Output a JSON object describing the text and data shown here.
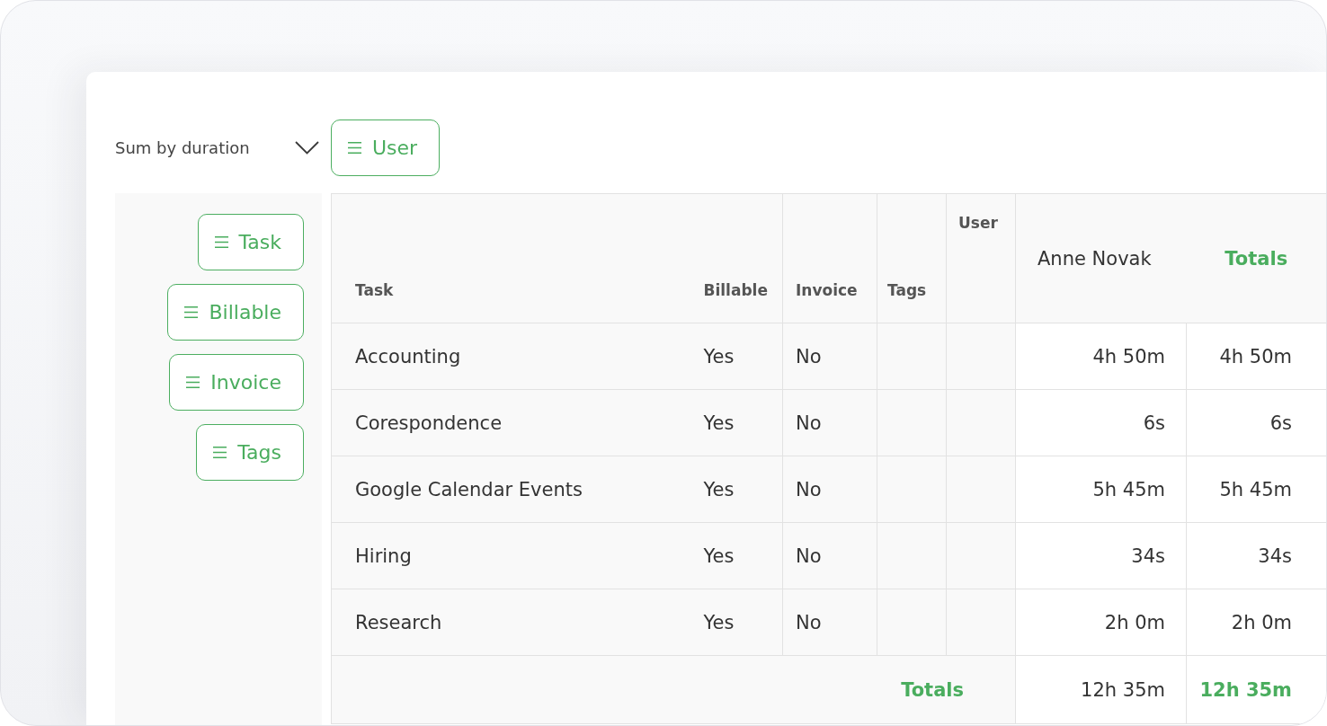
{
  "toolbar": {
    "sum_by": "Sum by duration",
    "column_fields": [
      {
        "label": "User"
      }
    ]
  },
  "row_fields": [
    {
      "label": "Task"
    },
    {
      "label": "Billable"
    },
    {
      "label": "Invoice"
    },
    {
      "label": "Tags"
    }
  ],
  "table": {
    "columns": [
      {
        "label": "Task"
      },
      {
        "label": "Billable"
      },
      {
        "label": "Invoice"
      },
      {
        "label": "Tags"
      }
    ],
    "column_field": {
      "label": "User"
    },
    "users": [
      {
        "name": "Anne Novak"
      }
    ],
    "totals_label": "Totals",
    "rows": [
      {
        "cells": [
          "Accounting",
          "Yes",
          "No"
        ],
        "values": [
          "4h 50m"
        ],
        "total": "4h 50m"
      },
      {
        "cells": [
          "Corespondence",
          "Yes",
          "No"
        ],
        "values": [
          "6s"
        ],
        "total": "6s"
      },
      {
        "cells": [
          "Google Calendar Events",
          "Yes",
          "No"
        ],
        "values": [
          "5h 45m"
        ],
        "total": "5h 45m"
      },
      {
        "cells": [
          "Hiring",
          "Yes",
          "No"
        ],
        "values": [
          "34s"
        ],
        "total": "34s"
      },
      {
        "cells": [
          "Research",
          "Yes",
          "No"
        ],
        "values": [
          "2h 0m"
        ],
        "total": "2h 0m"
      }
    ],
    "totals_row": {
      "label": "Totals",
      "values": [
        "12h 35m"
      ],
      "total": "12h 35m"
    }
  }
}
